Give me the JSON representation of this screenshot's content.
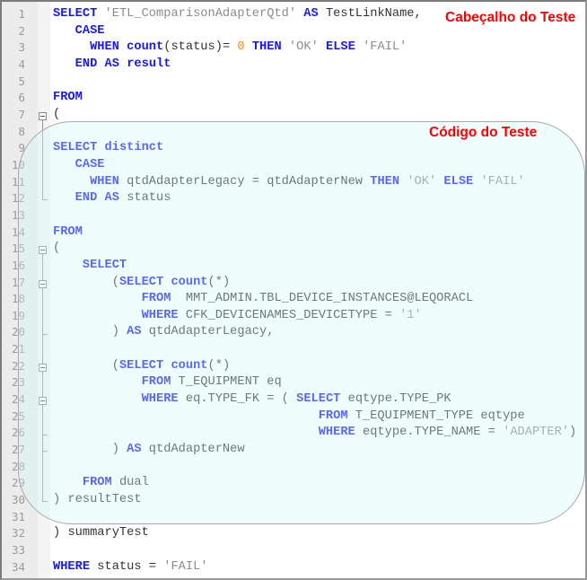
{
  "annotations": {
    "header_label": "Cabeçalho do Teste",
    "code_label": "Código do Teste"
  },
  "colors": {
    "keyword": "#1a1aee",
    "string": "#8c8c8c",
    "number": "#ff8c1a",
    "annotation": "#ff0000",
    "region_fill": "#eefbfb"
  },
  "keywords": [
    "SELECT",
    "AS",
    "CASE",
    "WHEN",
    "THEN",
    "ELSE",
    "END",
    "FROM",
    "WHERE",
    "count",
    "result",
    "distinct"
  ],
  "editor": {
    "lines": [
      "SELECT 'ETL_ComparisonAdapterQtd' AS TestLinkName,",
      "   CASE",
      "     WHEN count(status)= 0 THEN 'OK' ELSE 'FAIL'",
      "   END AS result",
      "",
      "FROM",
      "(",
      "",
      "SELECT distinct",
      "   CASE",
      "     WHEN qtdAdapterLegacy = qtdAdapterNew THEN 'OK' ELSE 'FAIL'",
      "   END AS status",
      "",
      "FROM",
      "(",
      "    SELECT",
      "        (SELECT count(*)",
      "            FROM  MMT_ADMIN.TBL_DEVICE_INSTANCES@LEQORACL",
      "            WHERE CFK_DEVICENAMES_DEVICETYPE = '1'",
      "        ) AS qtdAdapterLegacy,",
      "",
      "        (SELECT count(*)",
      "            FROM T_EQUIPMENT eq",
      "            WHERE eq.TYPE_FK = ( SELECT eqtype.TYPE_PK",
      "                                    FROM T_EQUIPMENT_TYPE eqtype",
      "                                    WHERE eqtype.TYPE_NAME = 'ADAPTER')",
      "        ) AS qtdAdapterNew",
      "",
      "    FROM dual",
      ") resultTest",
      "",
      ") summaryTest",
      "",
      "WHERE status = 'FAIL'"
    ]
  }
}
